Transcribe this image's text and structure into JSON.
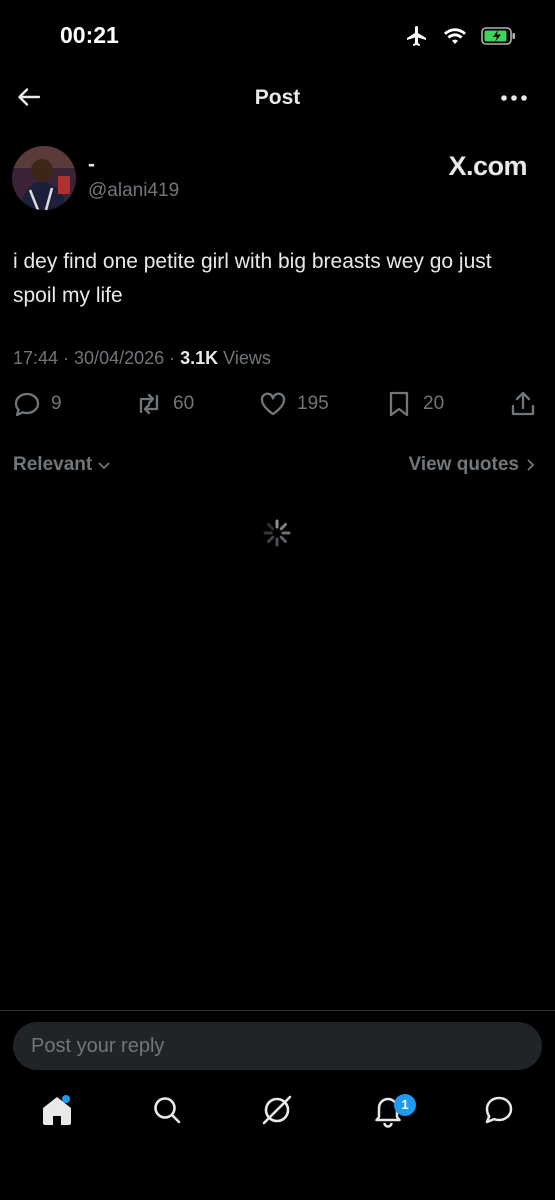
{
  "status_bar": {
    "time": "00:21",
    "icons": [
      "airplane-icon",
      "wifi-icon",
      "battery-charging-icon"
    ]
  },
  "header": {
    "title": "Post",
    "back_icon": "arrow-left-icon",
    "more_icon": "more-icon"
  },
  "post": {
    "display_name": "-",
    "handle": "@alani419",
    "source_label": "X.com",
    "text": "i dey find one petite girl with big breasts wey go just spoil my life",
    "timestamp": "17:44 · 30/04/2026 · ",
    "views_count": "3.1K",
    "views_label": " Views",
    "actions": {
      "replies": "9",
      "reposts": "60",
      "likes": "195",
      "bookmarks": "20"
    }
  },
  "filters": {
    "sort_label": "Relevant",
    "view_quotes_label": "View quotes"
  },
  "reply": {
    "placeholder": "Post your reply"
  },
  "tabbar": {
    "notifications_badge": "1"
  },
  "colors": {
    "background": "#000000",
    "text": "#e7e9ea",
    "muted": "#71767b",
    "accent": "#1d9bf0",
    "battery": "#3ed35b"
  }
}
